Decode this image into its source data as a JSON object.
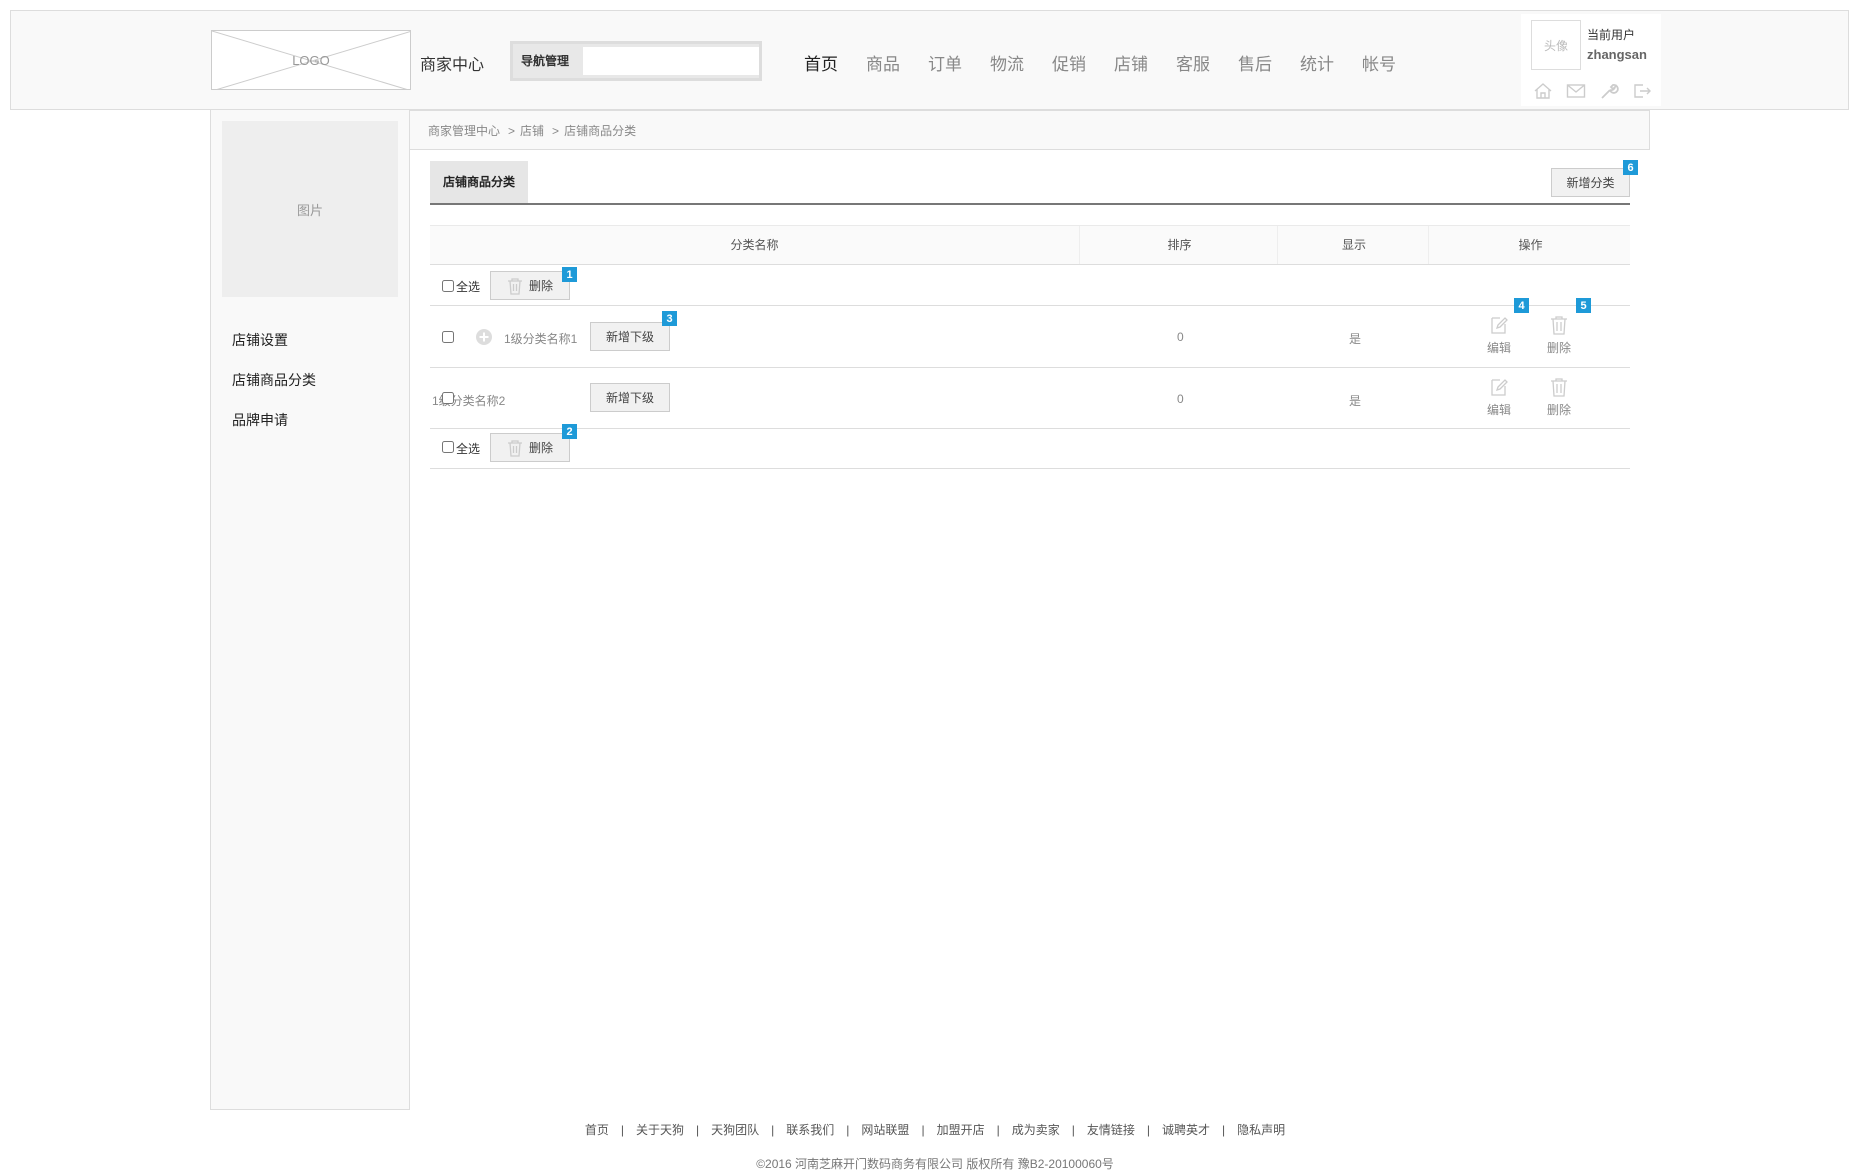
{
  "header": {
    "logo_text": "LOGO",
    "merchant_center": "商家中心",
    "nav_manage_label": "导航管理",
    "nav": [
      "首页",
      "商品",
      "订单",
      "物流",
      "促销",
      "店铺",
      "客服",
      "售后",
      "统计",
      "帐号"
    ],
    "user": {
      "avatar_text": "头像",
      "current_user_label": "当前用户",
      "username": "zhangsan",
      "icons": [
        "home-icon",
        "mail-icon",
        "wrench-icon",
        "logout-icon"
      ]
    }
  },
  "sidebar": {
    "picture_text": "图片",
    "items": [
      "店铺设置",
      "店铺商品分类",
      "品牌申请"
    ]
  },
  "breadcrumb": [
    "商家管理中心",
    "店铺",
    "店铺商品分类"
  ],
  "breadcrumb_sep": ">",
  "tab": {
    "label": "店铺商品分类"
  },
  "add_category_button": "新增分类",
  "table": {
    "columns": [
      "分类名称",
      "排序",
      "显示",
      "操作"
    ],
    "select_all": "全选",
    "delete_label": "删除",
    "add_sub_label": "新增下级",
    "rows": [
      {
        "name": "1级分类名称1",
        "order": "0",
        "show": "是",
        "edit": "编辑",
        "delete": "删除"
      },
      {
        "name": "1级分类名称2",
        "order": "0",
        "show": "是",
        "edit": "编辑",
        "delete": "删除"
      }
    ]
  },
  "badges": [
    "1",
    "2",
    "3",
    "4",
    "5",
    "6"
  ],
  "footer": {
    "links": [
      "首页",
      "关于天狗",
      "天狗团队",
      "联系我们",
      "网站联盟",
      "加盟开店",
      "成为卖家",
      "友情链接",
      "诚聘英才",
      "隐私声明"
    ],
    "separator": "|",
    "copyright": "©2016 河南芝麻开门数码商务有限公司 版权所有 豫B2-20100060号"
  },
  "colors": {
    "badge": "#1e9ad8",
    "sidebar_bg": "#f9f9f9",
    "border": "#dddddd"
  }
}
